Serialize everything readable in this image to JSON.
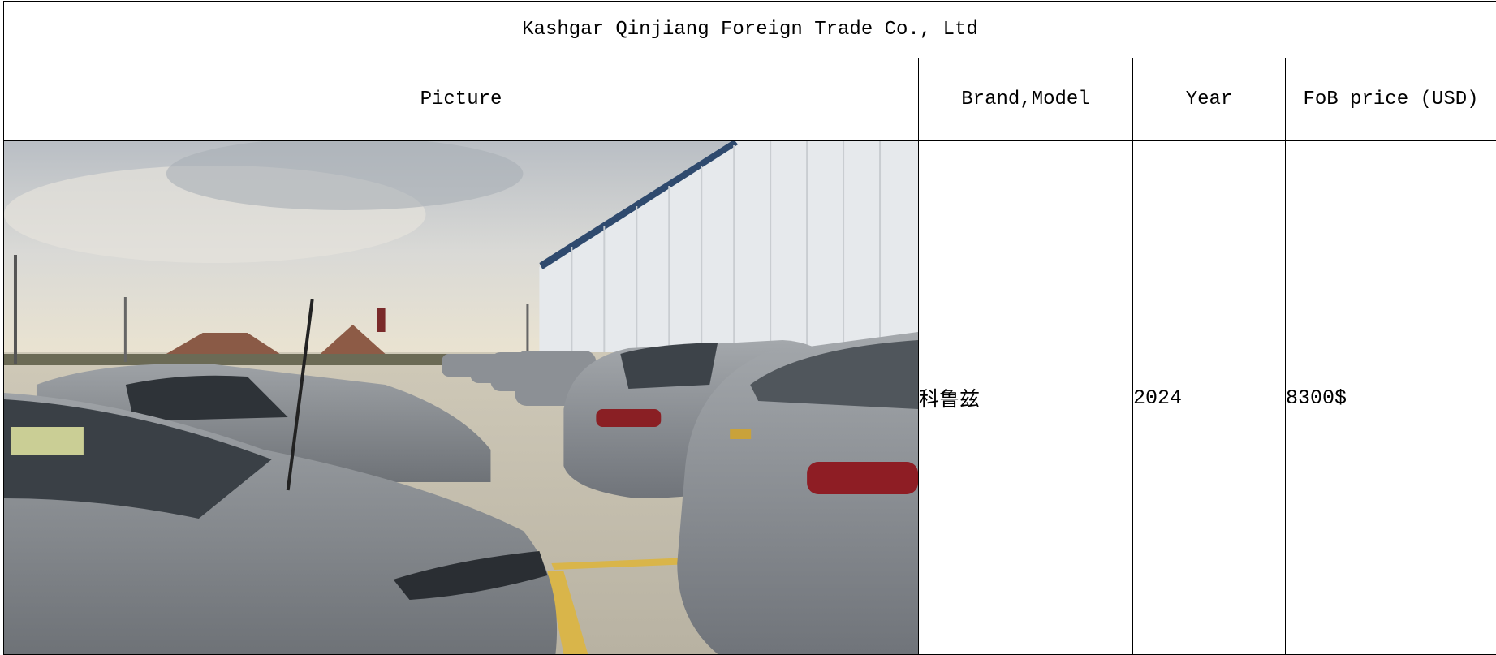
{
  "title": "Kashgar Qinjiang Foreign Trade Co., Ltd",
  "headers": {
    "picture": "Picture",
    "brand_model": "Brand,Model",
    "year": "Year",
    "fob_price": "FoB price (USD)"
  },
  "rows": [
    {
      "picture_icon": "car-lot-photo",
      "brand_model": "科鲁兹",
      "year": "2024",
      "fob_price": "8300$"
    }
  ],
  "colors": {
    "border": "#000000",
    "background": "#ffffff",
    "car_body": "#8a8e92",
    "sky": "#d7dadd",
    "warehouse_wall": "#e9ecef"
  }
}
